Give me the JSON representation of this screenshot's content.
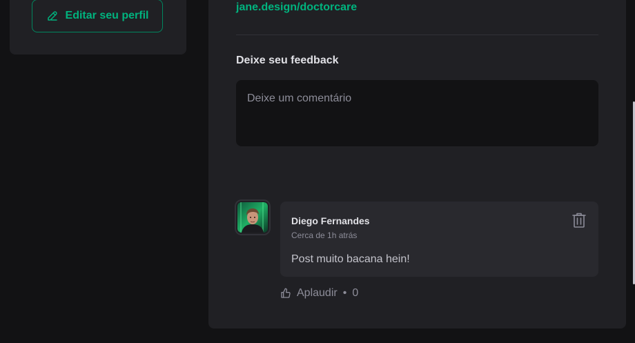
{
  "sidebar": {
    "edit_profile_label": "Editar seu perfil"
  },
  "post": {
    "link_text": "jane.design/doctorcare"
  },
  "feedback": {
    "title": "Deixe seu feedback",
    "placeholder": "Deixe um comentário"
  },
  "comment": {
    "author": "Diego Fernandes",
    "time": "Cerca de 1h atrás",
    "text": "Post muito bacana hein!",
    "applaud_label": "Aplaudir",
    "separator": "•",
    "applaud_count": "0"
  },
  "colors": {
    "background": "#121214",
    "card": "#202024",
    "comment_card": "#29292e",
    "accent": "#00b37e",
    "accent_border": "#00875f",
    "text_primary": "#e1e1e6",
    "text_muted": "#8d8d99"
  },
  "icons": {
    "edit": "pencil-icon",
    "delete": "trash-icon",
    "applaud": "thumbs-up-icon"
  }
}
